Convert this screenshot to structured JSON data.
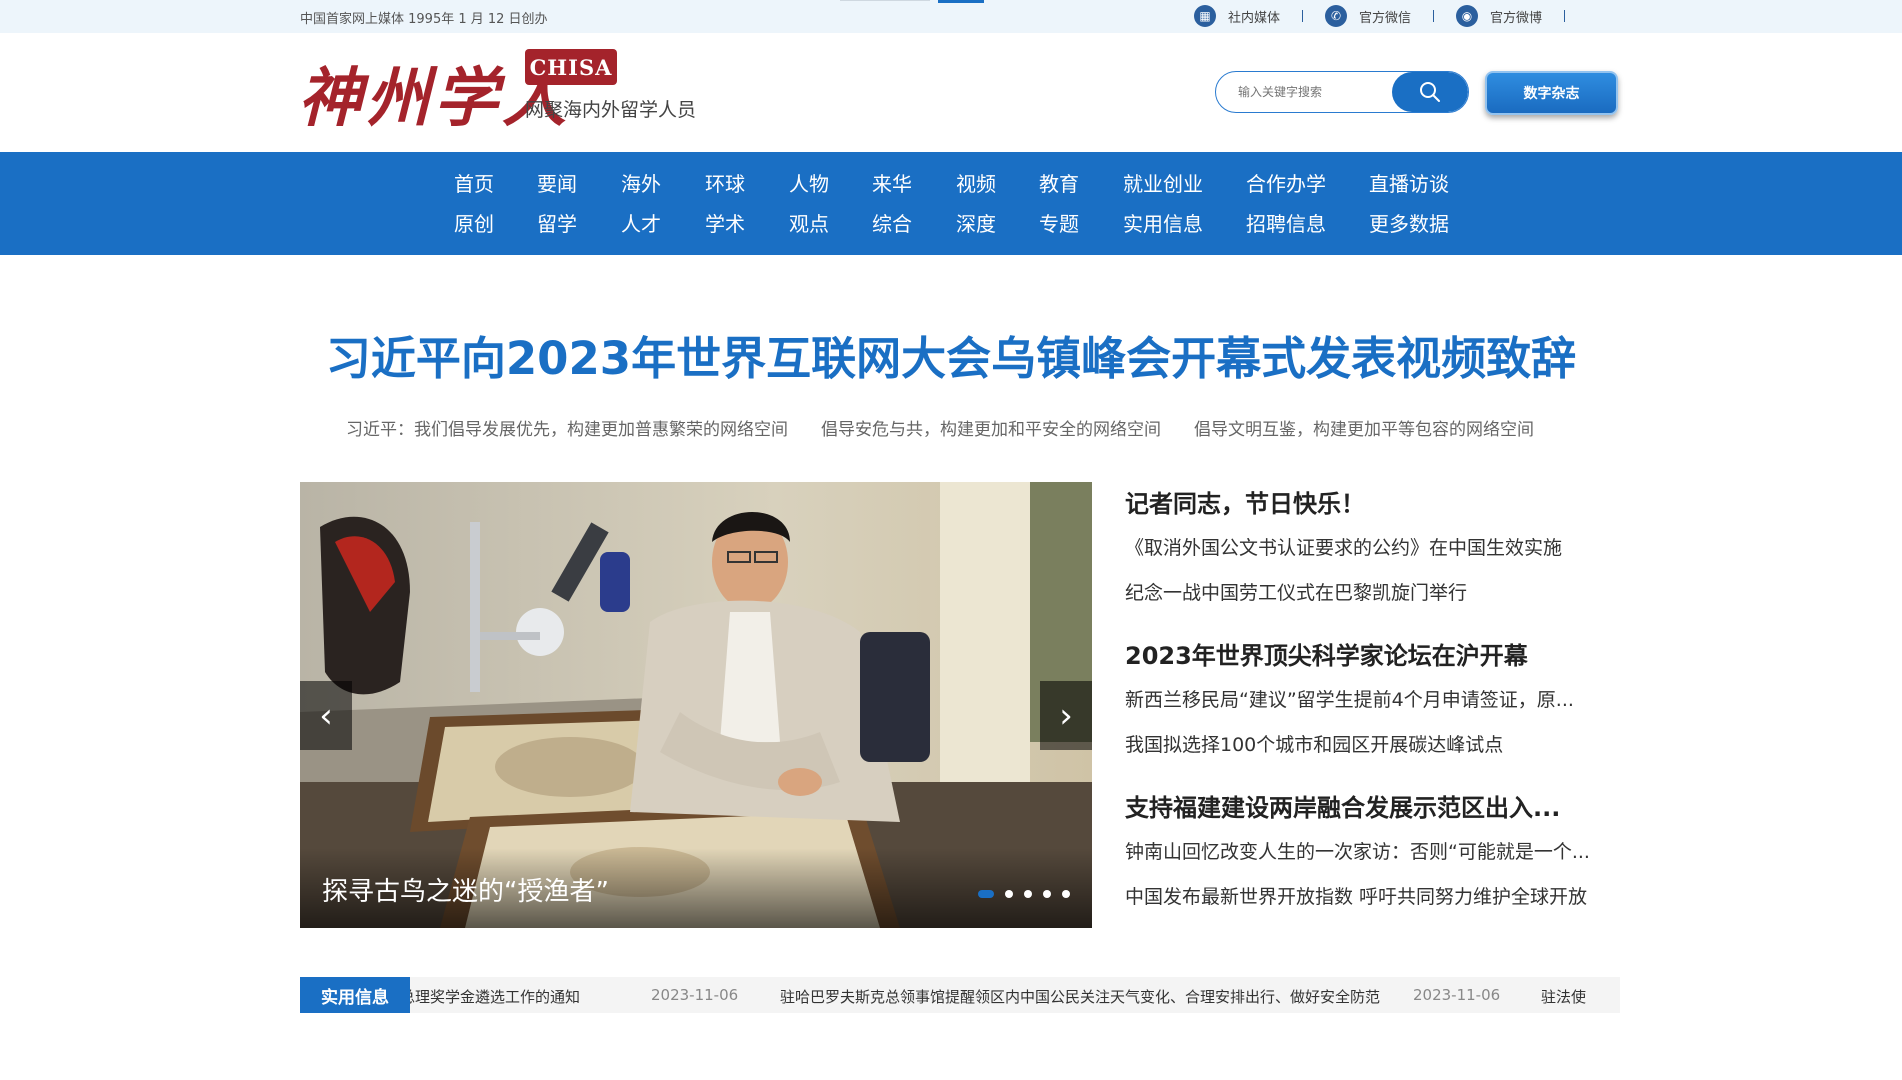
{
  "topbar": {
    "since": "中国首家网上媒体 1995年 1 月 12 日创办",
    "links": [
      "社内媒体",
      "官方微信",
      "官方微博"
    ]
  },
  "header": {
    "logo_text": "神州学人",
    "logo_badge": "CHISA",
    "slogan": "网聚海内外留学人员",
    "search_placeholder": "输入关键字搜索",
    "magazine_button": "数字杂志"
  },
  "nav": {
    "row1": [
      "首页",
      "要闻",
      "海外",
      "环球",
      "人物",
      "来华",
      "视频",
      "教育",
      "就业创业",
      "合作办学",
      "直播访谈"
    ],
    "row2": [
      "原创",
      "留学",
      "人才",
      "学术",
      "观点",
      "综合",
      "深度",
      "专题",
      "实用信息",
      "招聘信息",
      "更多数据"
    ]
  },
  "headline": {
    "title": "习近平向2023年世界互联网大会乌镇峰会开幕式发表视频致辞",
    "subs": [
      "习近平：我们倡导发展优先，构建更加普惠繁荣的网络空间",
      "倡导安危与共，构建更加和平安全的网络空间",
      "倡导文明互鉴，构建更加平等包容的网络空间"
    ]
  },
  "slider": {
    "caption": "探寻古鸟之迷的“授渔者”",
    "slide_count": 5,
    "active_index": 0
  },
  "news": [
    {
      "title": "记者同志，节日快乐！",
      "items": [
        "《取消外国公文书认证要求的公约》在中国生效实施",
        "纪念一战中国劳工仪式在巴黎凯旋门举行"
      ]
    },
    {
      "title": "2023年世界顶尖科学家论坛在沪开幕",
      "items": [
        "新西兰移民局“建议”留学生提前4个月申请签证，原...",
        "我国拟选择100个城市和园区开展碳达峰试点"
      ]
    },
    {
      "title": "支持福建建设两岸融合发展示范区出入...",
      "items": [
        "钟南山回忆改变人生的一次家访：否则“可能就是一个...",
        "中国发布最新世界开放指数 呼吁共同努力维护全球开放"
      ]
    }
  ],
  "ticker": {
    "label": "实用信息",
    "entries": [
      {
        "text": "总理奖学金遴选工作的通知",
        "date": "2023-11-06"
      },
      {
        "text": "驻哈巴罗夫斯克总领事馆提醒领区内中国公民关注天气变化、合理安排出行、做好安全防范",
        "date": "2023-11-06"
      },
      {
        "text": "驻法使",
        "date": ""
      }
    ]
  },
  "colors": {
    "brand_blue": "#1a6fc4",
    "logo_red": "#a4232b",
    "topbar_bg": "#edf5fb"
  }
}
